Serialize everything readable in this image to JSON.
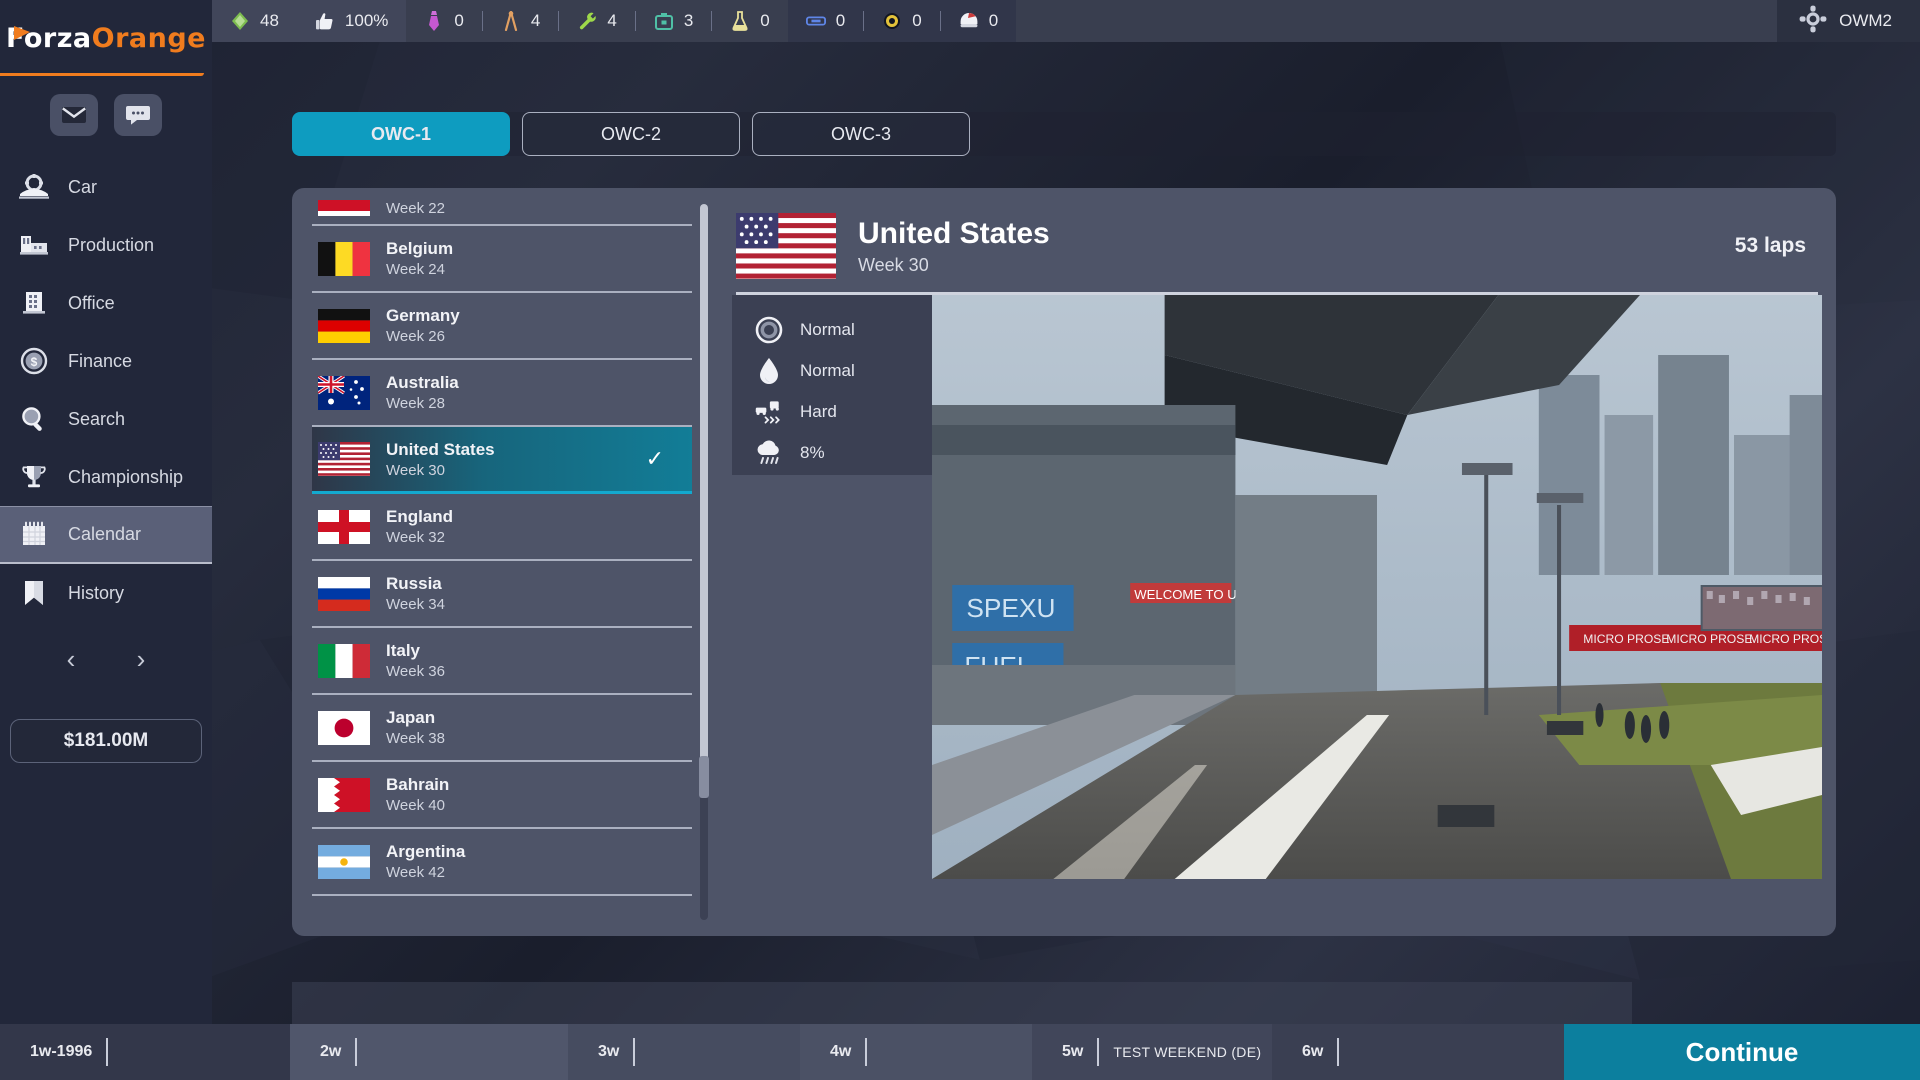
{
  "brand": {
    "name_part1": "Forza",
    "name_part2": "Orange"
  },
  "topbar": {
    "stats": [
      {
        "icon": "gem-icon",
        "value": "48"
      },
      {
        "icon": "thumbs-up-icon",
        "value": "100%"
      },
      {
        "icon": "tie-icon",
        "value": "0"
      },
      {
        "icon": "compass-icon",
        "value": "4"
      },
      {
        "icon": "wrench-icon",
        "value": "4"
      },
      {
        "icon": "toolbox-icon",
        "value": "3"
      },
      {
        "icon": "flask-icon",
        "value": "0"
      },
      {
        "icon": "car-front-icon",
        "value": "0"
      },
      {
        "icon": "medal-icon",
        "value": "0"
      },
      {
        "icon": "helmet-icon",
        "value": "0"
      }
    ],
    "team": {
      "icon": "gear-icon",
      "label": "OWM2"
    }
  },
  "sidebar": {
    "quick_buttons": [
      {
        "icon": "mail-icon",
        "label": "Inbox"
      },
      {
        "icon": "chat-icon",
        "label": "Messages"
      }
    ],
    "items": [
      {
        "icon": "car-icon",
        "label": "Car",
        "active": false
      },
      {
        "icon": "factory-icon",
        "label": "Production",
        "active": false
      },
      {
        "icon": "office-building-icon",
        "label": "Office",
        "active": false
      },
      {
        "icon": "dollar-coin-icon",
        "label": "Finance",
        "active": false
      },
      {
        "icon": "magnifier-icon",
        "label": "Search",
        "active": false
      },
      {
        "icon": "trophy-icon",
        "label": "Championship",
        "active": false
      },
      {
        "icon": "calendar-icon",
        "label": "Calendar",
        "active": true
      },
      {
        "icon": "bookmark-icon",
        "label": "History",
        "active": false
      }
    ],
    "pager": {
      "prev": "‹",
      "next": "›"
    },
    "money": "$181.00M"
  },
  "tabs": [
    {
      "label": "OWC-1",
      "active": true
    },
    {
      "label": "OWC-2",
      "active": false
    },
    {
      "label": "OWC-3",
      "active": false
    }
  ],
  "race_list": [
    {
      "country": "",
      "week": "Week 22",
      "flag": "monaco",
      "selected": false,
      "partial": true
    },
    {
      "country": "Belgium",
      "week": "Week 24",
      "flag": "belgium",
      "selected": false
    },
    {
      "country": "Germany",
      "week": "Week 26",
      "flag": "germany",
      "selected": false
    },
    {
      "country": "Australia",
      "week": "Week 28",
      "flag": "australia",
      "selected": false
    },
    {
      "country": "United States",
      "week": "Week 30",
      "flag": "usa",
      "selected": true
    },
    {
      "country": "England",
      "week": "Week 32",
      "flag": "england",
      "selected": false
    },
    {
      "country": "Russia",
      "week": "Week 34",
      "flag": "russia",
      "selected": false
    },
    {
      "country": "Italy",
      "week": "Week 36",
      "flag": "italy",
      "selected": false
    },
    {
      "country": "Japan",
      "week": "Week 38",
      "flag": "japan",
      "selected": false
    },
    {
      "country": "Bahrain",
      "week": "Week 40",
      "flag": "bahrain",
      "selected": false
    },
    {
      "country": "Argentina",
      "week": "Week 42",
      "flag": "argentina",
      "selected": false
    }
  ],
  "detail": {
    "country": "United States",
    "week": "Week 30",
    "laps": "53 laps",
    "flag": "usa",
    "stats": [
      {
        "icon": "tyre-icon",
        "label": "Tyre wear",
        "value": "Normal"
      },
      {
        "icon": "fuel-drop-icon",
        "label": "Fuel usage",
        "value": "Normal"
      },
      {
        "icon": "overtake-icon",
        "label": "Overtaking",
        "value": "Hard"
      },
      {
        "icon": "rain-cloud-icon",
        "label": "Rain chance",
        "value": "8%"
      }
    ]
  },
  "timeline": {
    "segments": [
      {
        "label": "1w-1996",
        "note": ""
      },
      {
        "label": "2w",
        "note": ""
      },
      {
        "label": "3w",
        "note": ""
      },
      {
        "label": "4w",
        "note": ""
      },
      {
        "label": "5w",
        "note": "TEST WEEKEND (DE)"
      },
      {
        "label": "6w",
        "note": ""
      }
    ],
    "continue_label": "Continue"
  },
  "colors": {
    "accent_teal": "#0e9cc0",
    "accent_orange": "#f07c1e",
    "panel": "#4e5468",
    "sidebar": "#22273a"
  }
}
